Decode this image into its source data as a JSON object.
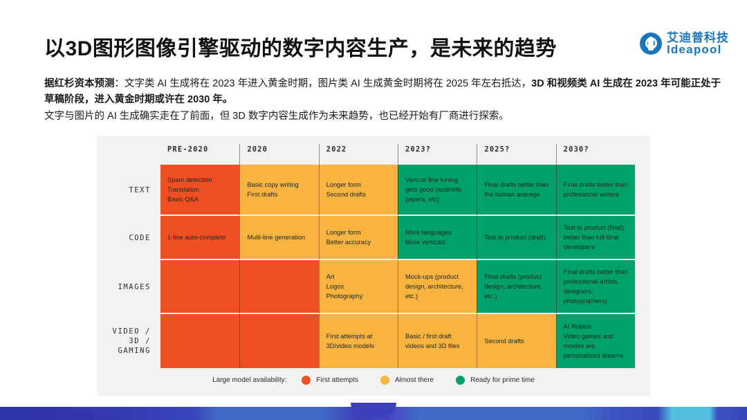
{
  "header": {
    "title": "以3D图形图像引擎驱动的数字内容生产，是未来的趋势",
    "logo": {
      "cn": "艾迪普科技",
      "en": "Ideapool",
      "color": "#1B75BC"
    }
  },
  "body": {
    "para1_bold_lead": "据红杉资本预测",
    "para1_rest": "：文字类 AI 生成将在 2023 年进入黄金时期，图片类 AI 生成黄金时期将在 2025 年左右抵达，",
    "para1_bold_tail": "3D 和视频类 AI 生成在 2023 年可能正处于草稿阶段，进入黄金时期或许在 2030 年。",
    "para2": "文字与图片的 AI 生成确实走在了前面，但 3D 数字内容生成作为未来趋势，也已经开始有厂商进行探索。"
  },
  "chart_data": {
    "type": "heatmap",
    "title": "",
    "xlabel": "",
    "ylabel": "",
    "legend_position": "bottom",
    "legend_title": "Large model availability:",
    "colors": {
      "red": "#F04E23",
      "amber": "#F9B340",
      "green": "#00A06B",
      "background": "#F2F2F0"
    },
    "legend": [
      {
        "label": "First attempts",
        "color": "#F04E23",
        "level": "red"
      },
      {
        "label": "Almost there",
        "color": "#F9B340",
        "level": "amber"
      },
      {
        "label": "Ready for prime time",
        "color": "#00A06B",
        "level": "green"
      }
    ],
    "categories": [
      "PRE-2020",
      "2020",
      "2022",
      "2023?",
      "2025?",
      "2030?"
    ],
    "rows": [
      {
        "label": "TEXT",
        "cells": [
          {
            "level": "red",
            "lines": [
              "Spam detection",
              "Translation",
              "Basic Q&A"
            ]
          },
          {
            "level": "amber",
            "lines": [
              "Basic copy writing",
              "First drafts"
            ]
          },
          {
            "level": "amber",
            "lines": [
              "Longer form",
              "Second drafts"
            ]
          },
          {
            "level": "green",
            "lines": [
              "Vertical fine tuning gets good (scientific papers, etc)"
            ]
          },
          {
            "level": "green",
            "lines": [
              "Final drafts better than the human average"
            ]
          },
          {
            "level": "green",
            "lines": [
              "Final drafts better than professional writers"
            ]
          }
        ]
      },
      {
        "label": "CODE",
        "cells": [
          {
            "level": "red",
            "lines": [
              "1-line auto-complete"
            ]
          },
          {
            "level": "amber",
            "lines": [
              "Multi-line generation"
            ]
          },
          {
            "level": "amber",
            "lines": [
              "Longer form",
              "Better accuracy"
            ]
          },
          {
            "level": "green",
            "lines": [
              "More languages",
              "More verticals"
            ]
          },
          {
            "level": "green",
            "lines": [
              "Text to product (draft)"
            ]
          },
          {
            "level": "green",
            "lines": [
              "Text to product (final), better than full-time developers"
            ]
          }
        ]
      },
      {
        "label": "IMAGES",
        "cells": [
          {
            "level": "red",
            "lines": []
          },
          {
            "level": "red",
            "lines": []
          },
          {
            "level": "amber",
            "lines": [
              "Art",
              "Logos",
              "Photography"
            ]
          },
          {
            "level": "amber",
            "lines": [
              "Mock-ups (product design, architecture, etc.)"
            ]
          },
          {
            "level": "green",
            "lines": [
              "Final drafts (product design, architecture, etc.)"
            ]
          },
          {
            "level": "green",
            "lines": [
              "Final drafts better than professional artists, designers, photographers)"
            ]
          }
        ]
      },
      {
        "label": "VIDEO /\n3D /\nGAMING",
        "cells": [
          {
            "level": "red",
            "lines": []
          },
          {
            "level": "red",
            "lines": []
          },
          {
            "level": "amber",
            "lines": [
              "First attempts at 3D/video models"
            ]
          },
          {
            "level": "amber",
            "lines": [
              "Basic / first draft videos and 3D files"
            ]
          },
          {
            "level": "amber",
            "lines": [
              "Second drafts"
            ]
          },
          {
            "level": "green",
            "lines": [
              "AI Roblox",
              "Video games and movies are personalized dreams"
            ]
          }
        ]
      }
    ]
  }
}
